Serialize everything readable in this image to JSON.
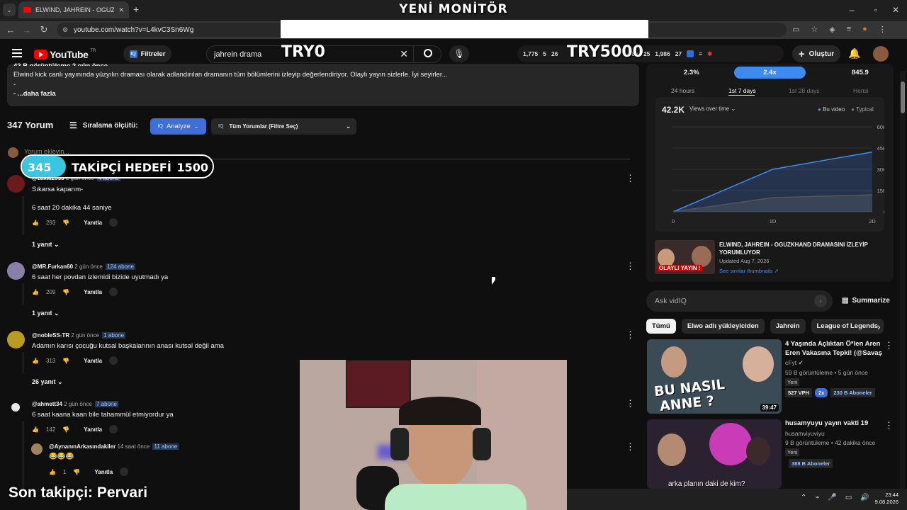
{
  "browser": {
    "tab_title": "ELWIND, JAHREIN - OGUZKHAN",
    "url": "youtube.com/watch?v=L4kvC3Sn6Wg",
    "new_tab": "+"
  },
  "overlay": {
    "monitor_title": "YENİ MONİTÖR",
    "try0": "TRY0",
    "try5000": "TRY5000",
    "follower_current": "345",
    "follower_label": "TAKİPÇİ HEDEFİ",
    "follower_goal": "1500",
    "follower_progress": 0.23,
    "last_follower": "Son takipçi: Pervari"
  },
  "youtube": {
    "logo": "YouTube",
    "logo_sup": "TR",
    "filters_label": "Filtreler",
    "search_value": "jahrein drama",
    "stats": [
      "1,775",
      "5",
      "26",
      "8k",
      "25",
      "1,986",
      "27"
    ],
    "create_label": "Oluştur"
  },
  "description": {
    "line0": "42 B görüntüleme  2 gün önce",
    "line1": "Elwind kick canlı yayınında yüzyılın draması olarak adlandırılan dramanın tüm bölümlerini izleyip değerlendiriyor. Olaylı yayın sizlerle. İyi seyirler...",
    "line2": "-",
    "line3": "- ...daha fazla"
  },
  "comments_header": {
    "count": "347 Yorum",
    "sort_label": "Sıralama ölçütü:",
    "analyze_label": "Analyze",
    "filter_label": "Tüm Yorumlar (Filtre Seç)",
    "add_placeholder": "Yorum ekleyin..."
  },
  "comments": [
    {
      "user": "@zakat2553",
      "time": "2 gün önce",
      "subs": "4 abone",
      "text1": "Sıkarsa kaparım-",
      "text2": "6 saat 20 dakika 44 saniye",
      "likes": "293",
      "reply_label": "Yanıtla",
      "replies": "1 yanıt",
      "avatar_color": "#6b1b1b"
    },
    {
      "user": "@MR.Furkan60",
      "time": "2 gün önce",
      "subs": "124 abone",
      "text1": "6 saat her povdan izlemidi bizide uyutmadı ya",
      "likes": "209",
      "reply_label": "Yanıtla",
      "replies": "1 yanıt",
      "avatar_color": "#8a7fa8"
    },
    {
      "user": "@nobleSS-TR",
      "time": "2 gün önce",
      "subs": "1 abone",
      "text1": "Adamın karısı çocuğu kutsal başkalarının anası kutsal değil ama",
      "likes": "313",
      "reply_label": "Yanıtla",
      "replies": "26 yanıt",
      "avatar_color": "#b89c20"
    },
    {
      "user": "@ahmett34",
      "time": "2 gün önce",
      "subs": "7 abone",
      "text1": "6 saat kaana kaan bile tahammül etmiyordur ya",
      "likes": "142",
      "reply_label": "Yanıtla",
      "avatar_color": "#e8e8e8"
    },
    {
      "user": "@AynanınArkasındakiler",
      "time": "14 saat önce",
      "subs": "11 abone",
      "text1": "😂😂😂",
      "likes": "1",
      "reply_label": "Yanıtla",
      "avatar_color": "#a0825c"
    }
  ],
  "stats_panel": {
    "top_values": [
      "2.3%",
      "2.4x",
      "845.9"
    ],
    "time_tabs": [
      "24 hours",
      "1st 7 days",
      "1st 28 days",
      "Hепsi"
    ],
    "views_total": "42.2K",
    "views_mode": "Views over time",
    "legend_this": "Bu video",
    "legend_typical": "Typical"
  },
  "chart_data": {
    "type": "area",
    "x": [
      "0",
      "1D",
      "2D"
    ],
    "series": [
      {
        "name": "Bu video",
        "values": [
          0,
          30000,
          42200
        ]
      },
      {
        "name": "Typical",
        "values": [
          0,
          10000,
          12000
        ]
      }
    ],
    "yticks": [
      "0",
      "15K",
      "30K",
      "45K",
      "60K"
    ],
    "ylim": [
      0,
      60000
    ],
    "grid": true,
    "legend": "top-right"
  },
  "video_info": {
    "title": "ELWIND, JAHREIN - OGUZKHAND DRAMASINI İZLEYİP YORUMLUYOR",
    "updated": "Updated Aug 7, 2026",
    "similar": "See similar thumbnails",
    "thumb_text": "OLAYLI YAYIN !"
  },
  "ask": {
    "placeholder": "Ask vidIQ",
    "summarize": "Summarize"
  },
  "chips": [
    "Tümü",
    "Elwo adlı yükleyiciden",
    "Jahrein",
    "League of Legends"
  ],
  "recommendations": [
    {
      "title1": "4 Yaşında Açlıktan Ö*len Aren",
      "title2": "Eren Vakasına Tepki! (@Savaş ...",
      "channel": "cFyt",
      "meta": "59 B görüntüleme • 5 gün önce",
      "badge": "Yeni",
      "vph": "527 VPH",
      "mult": "2x",
      "subs": "230 B Aboneler",
      "duration": "39:47",
      "thumb_text1": "BU NASIL",
      "thumb_text2": "ANNE ?"
    },
    {
      "title1": "husamyuyu yayın vakti 19",
      "channel": "husamviyuviyu",
      "meta": "9 B görüntüleme • 42 dakika önce",
      "badge": "Yeni",
      "subs": "388 B Aboneler",
      "caption": "arka planın daki de kim?"
    }
  ],
  "taskbar": {
    "time": "23:44",
    "date": "9.08.2026"
  }
}
